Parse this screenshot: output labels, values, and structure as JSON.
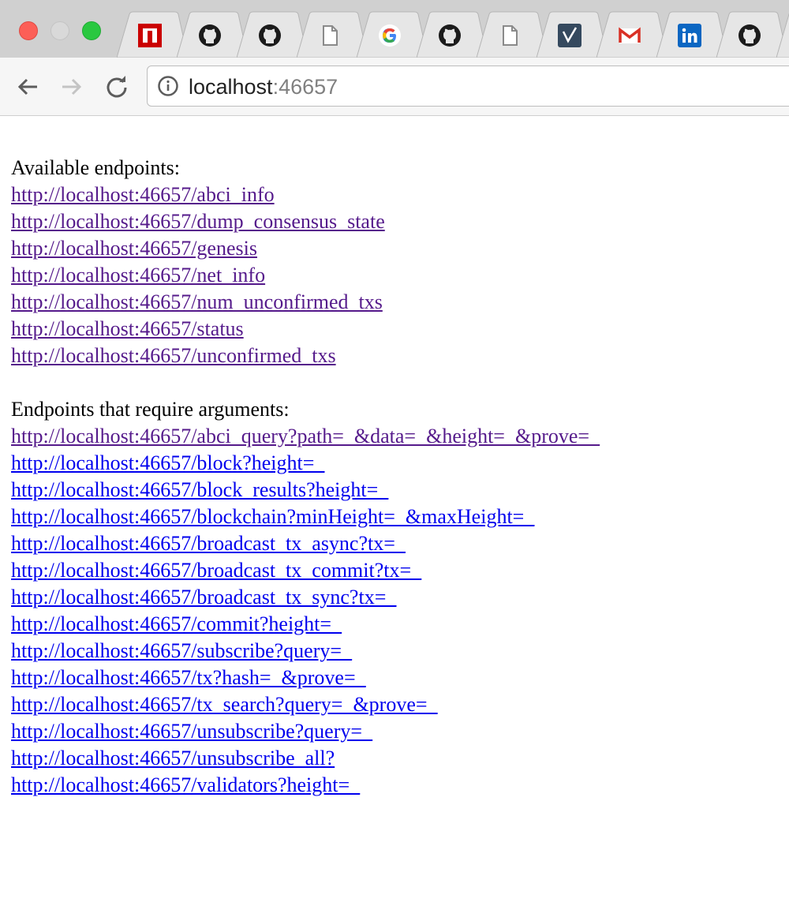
{
  "browser": {
    "tabs": [
      {
        "icon": "npm-icon"
      },
      {
        "icon": "github-icon"
      },
      {
        "icon": "github-icon"
      },
      {
        "icon": "blank-page-icon"
      },
      {
        "icon": "google-icon"
      },
      {
        "icon": "github-icon"
      },
      {
        "icon": "blank-page-icon"
      },
      {
        "icon": "vue-devtools-icon"
      },
      {
        "icon": "gmail-icon"
      },
      {
        "icon": "linkedin-icon"
      },
      {
        "icon": "github-icon"
      }
    ],
    "address_bar": {
      "host": "localhost",
      "port": ":46657"
    }
  },
  "page": {
    "available_heading": "Available endpoints:",
    "available_endpoints": [
      "http://localhost:46657/abci_info",
      "http://localhost:46657/dump_consensus_state",
      "http://localhost:46657/genesis",
      "http://localhost:46657/net_info",
      "http://localhost:46657/num_unconfirmed_txs",
      "http://localhost:46657/status",
      "http://localhost:46657/unconfirmed_txs"
    ],
    "args_heading": "Endpoints that require arguments:",
    "args_endpoints": [
      "http://localhost:46657/abci_query?path=_&data=_&height=_&prove=_",
      "http://localhost:46657/block?height=_",
      "http://localhost:46657/block_results?height=_",
      "http://localhost:46657/blockchain?minHeight=_&maxHeight=_",
      "http://localhost:46657/broadcast_tx_async?tx=_",
      "http://localhost:46657/broadcast_tx_commit?tx=_",
      "http://localhost:46657/broadcast_tx_sync?tx=_",
      "http://localhost:46657/commit?height=_",
      "http://localhost:46657/subscribe?query=_",
      "http://localhost:46657/tx?hash=_&prove=_",
      "http://localhost:46657/tx_search?query=_&prove=_",
      "http://localhost:46657/unsubscribe?query=_",
      "http://localhost:46657/unsubscribe_all?",
      "http://localhost:46657/validators?height=_"
    ],
    "colors": {
      "link_visited": "#551a8b",
      "link_unvisited": "#0000ee"
    }
  }
}
